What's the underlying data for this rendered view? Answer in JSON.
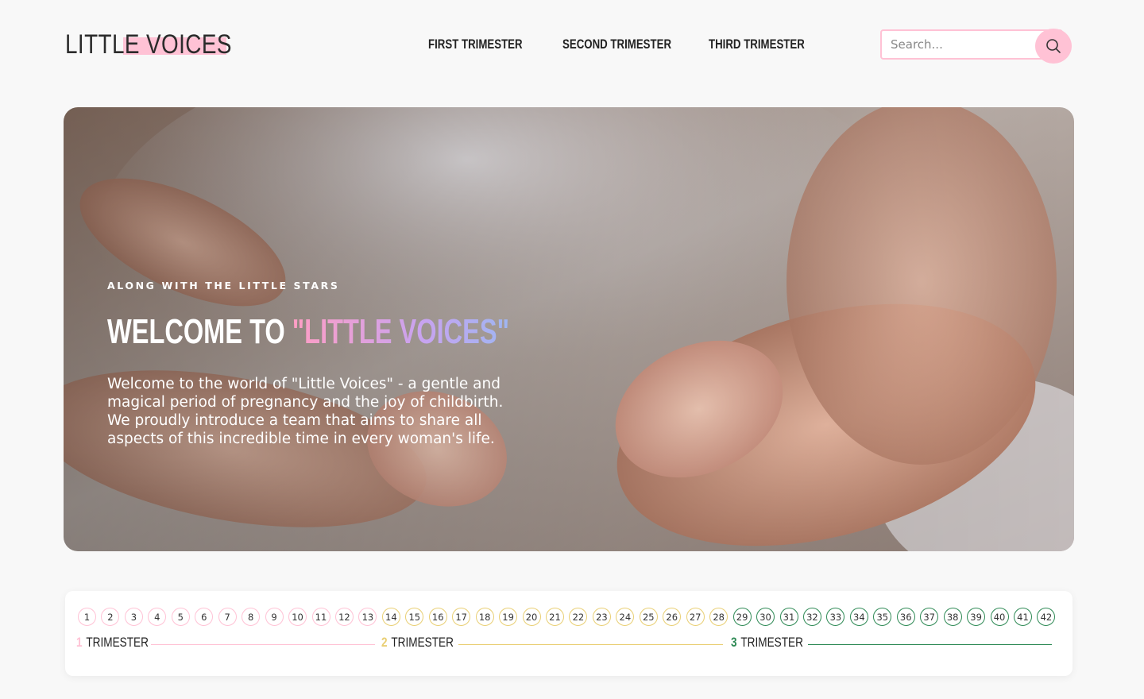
{
  "brand": {
    "logo_text": "LITTLE VOICES"
  },
  "nav": {
    "items": [
      "FIRST TRIMESTER",
      "SECOND TRIMESTER",
      "THIRD TRIMESTER"
    ]
  },
  "search": {
    "placeholder": "Search..."
  },
  "hero": {
    "kicker": "ALONG WITH THE LITTLE STARS",
    "title_prefix": "WELCOME TO ",
    "title_accent": "\"LITTLE VOICES\"",
    "body": "Welcome to the world of \"Little Voices\" - a gentle and magical period of pregnancy and the joy of childbirth. We proudly introduce a team that aims to share all aspects of this incredible time in every woman's life."
  },
  "timeline": {
    "weeks": [
      "1",
      "2",
      "3",
      "4",
      "5",
      "6",
      "7",
      "8",
      "9",
      "10",
      "11",
      "12",
      "13",
      "14",
      "15",
      "16",
      "17",
      "18",
      "19",
      "20",
      "21",
      "22",
      "23",
      "24",
      "25",
      "26",
      "27",
      "28",
      "29",
      "30",
      "31",
      "32",
      "33",
      "34",
      "35",
      "36",
      "37",
      "38",
      "39",
      "40",
      "41",
      "42"
    ],
    "trimesters": [
      {
        "number": "1",
        "label": "TRIMESTER",
        "color": "#ffc2d5"
      },
      {
        "number": "2",
        "label": "TRIMESTER",
        "color": "#e9cf74"
      },
      {
        "number": "3",
        "label": "TRIMESTER",
        "color": "#2e8a55"
      }
    ]
  },
  "colors": {
    "accent_pink": "#ffc2d5",
    "accent_yellow": "#e9cf74",
    "accent_green": "#2e8a55"
  },
  "icons": {
    "search": "search-icon"
  }
}
